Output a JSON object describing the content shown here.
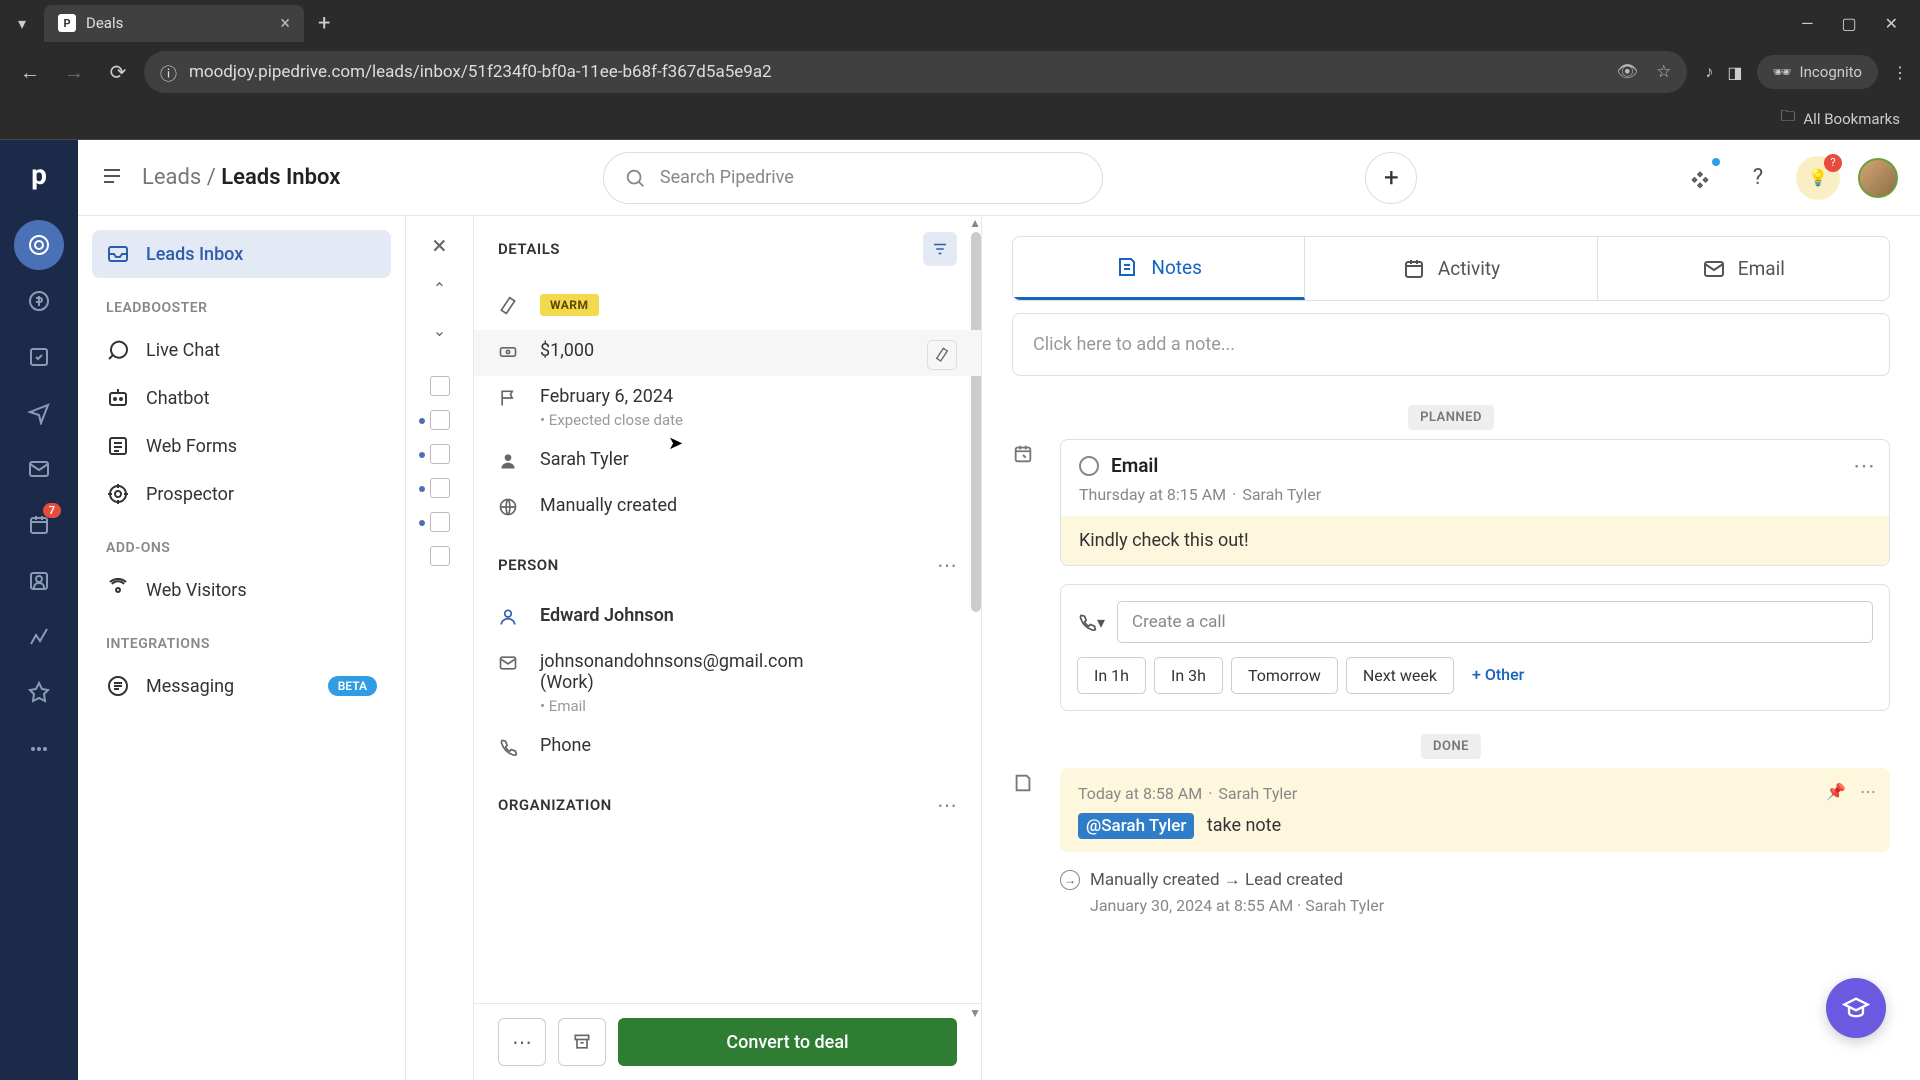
{
  "browser": {
    "tab_title": "Deals",
    "url": "moodjoy.pipedrive.com/leads/inbox/51f234f0-bf0a-11ee-b68f-f367d5a5e9a2",
    "incognito_label": "Incognito",
    "bookmarks_label": "All Bookmarks"
  },
  "topbar": {
    "breadcrumb_parent": "Leads",
    "breadcrumb_current": "Leads Inbox",
    "search_placeholder": "Search Pipedrive",
    "bulb_badge": "?"
  },
  "nav_badge": "7",
  "sidebar": {
    "leads_inbox": "Leads Inbox",
    "section_leadbooster": "LEADBOOSTER",
    "live_chat": "Live Chat",
    "chatbot": "Chatbot",
    "web_forms": "Web Forms",
    "prospector": "Prospector",
    "section_addons": "ADD-ONS",
    "web_visitors": "Web Visitors",
    "section_integrations": "INTEGRATIONS",
    "messaging": "Messaging",
    "beta_label": "BETA"
  },
  "details": {
    "title": "DETAILS",
    "temperature": "WARM",
    "value": "$1,000",
    "close_date": "February 6, 2024",
    "close_date_sub": "Expected close date",
    "owner": "Sarah Tyler",
    "source": "Manually created",
    "person_title": "PERSON",
    "person_name": "Edward Johnson",
    "person_email": "johnsonandohnsons@gmail.com",
    "person_email_type": "(Work)",
    "person_email_sub": "Email",
    "person_phone": "Phone",
    "org_title": "ORGANIZATION",
    "convert_label": "Convert to deal"
  },
  "activity": {
    "tabs": {
      "notes": "Notes",
      "activity": "Activity",
      "email": "Email"
    },
    "note_placeholder": "Click here to add a note...",
    "planned_label": "PLANNED",
    "email_title": "Email",
    "email_time": "Thursday at 8:15 AM",
    "email_owner": "Sarah Tyler",
    "email_body": "Kindly check this out!",
    "qs_placeholder": "Create a call",
    "qs": {
      "h1": "In 1h",
      "h3": "In 3h",
      "tom": "Tomorrow",
      "nw": "Next week",
      "other": "+ Other"
    },
    "done_label": "DONE",
    "done_time": "Today at 8:58 AM",
    "done_owner": "Sarah Tyler",
    "mention": "@Sarah Tyler",
    "done_text": "take note",
    "created_line": "Manually created → Lead created",
    "created_time": "January 30, 2024 at 8:55 AM",
    "created_owner": "Sarah Tyler"
  }
}
